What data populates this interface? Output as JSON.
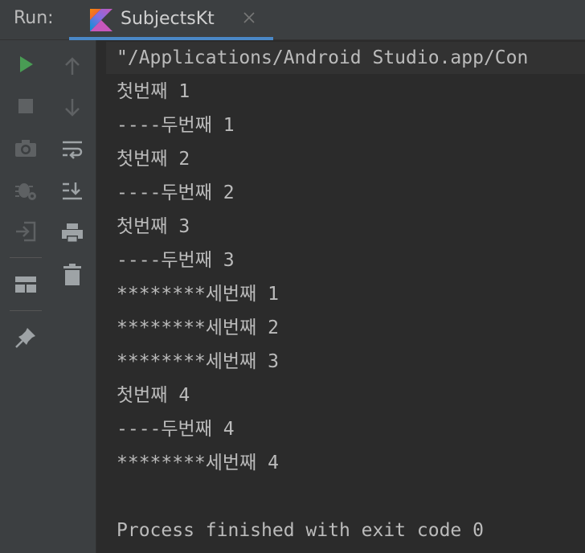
{
  "header": {
    "run_label": "Run:",
    "tab_title": "SubjectsKt",
    "tab_icon": "kotlin-icon",
    "close_icon": "close-icon"
  },
  "toolbar": {
    "icons": [
      "run-icon",
      "stop-icon",
      "camera-icon",
      "debug-icon",
      "exit-icon",
      "layout-icon",
      "pin-icon"
    ],
    "secondary_icons": [
      "arrow-up-icon",
      "arrow-down-icon",
      "soft-wrap-icon",
      "scroll-to-end-icon",
      "print-icon",
      "trash-icon"
    ]
  },
  "console": {
    "lines": [
      "\"/Applications/Android Studio.app/Con",
      "첫번째 1",
      "----두번째 1",
      "첫번째 2",
      "----두번째 2",
      "첫번째 3",
      "----두번째 3",
      "********세번째 1",
      "********세번째 2",
      "********세번째 3",
      "첫번째 4",
      "----두번째 4",
      "********세번째 4",
      "",
      "Process finished with exit code 0"
    ]
  },
  "colors": {
    "run_green": "#499c54",
    "accent_blue": "#4a88c7",
    "console_text": "#bbbbbb",
    "panel_bg": "#3c3f41",
    "console_bg": "#2b2b2b"
  }
}
